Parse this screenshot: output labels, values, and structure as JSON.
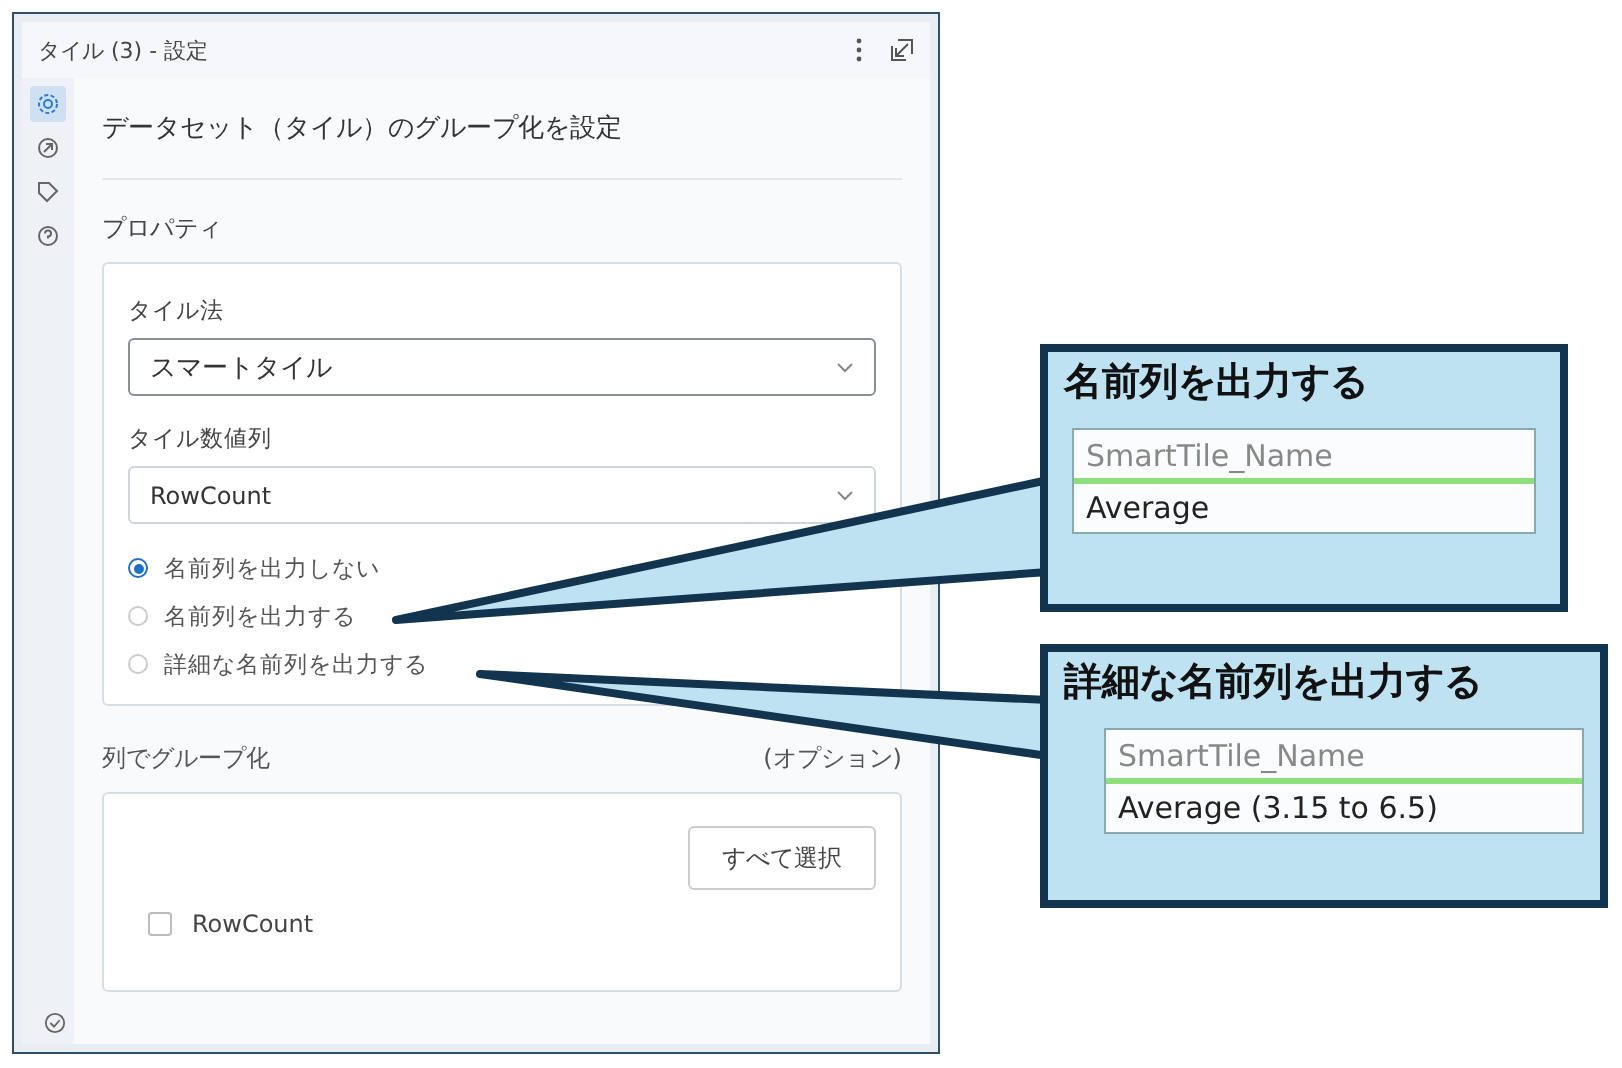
{
  "panel": {
    "title": "タイル (3) - 設定"
  },
  "side_tabs": [
    {
      "selected": true
    },
    {
      "selected": false
    },
    {
      "selected": false
    },
    {
      "selected": false
    }
  ],
  "description": "データセット（タイル）のグループ化を設定",
  "properties": {
    "heading": "プロパティ",
    "tile_method": {
      "label": "タイル法",
      "value": "スマートタイル"
    },
    "tile_column": {
      "label": "タイル数値列",
      "value": "RowCount"
    },
    "name_options": [
      {
        "label": "名前列を出力しない",
        "selected": true
      },
      {
        "label": "名前列を出力する",
        "selected": false
      },
      {
        "label": "詳細な名前列を出力する",
        "selected": false
      }
    ]
  },
  "group_by": {
    "label": "列でグループ化",
    "hint": "(オプション)",
    "select_all": "すべて選択",
    "columns": [
      {
        "label": "RowCount",
        "checked": false
      }
    ]
  },
  "callouts": [
    {
      "title": "名前列を出力する",
      "column_header": "SmartTile_Name",
      "value": "Average"
    },
    {
      "title": "詳細な名前列を出力する",
      "column_header": "SmartTile_Name",
      "value": "Average (3.15 to 6.5)"
    }
  ]
}
